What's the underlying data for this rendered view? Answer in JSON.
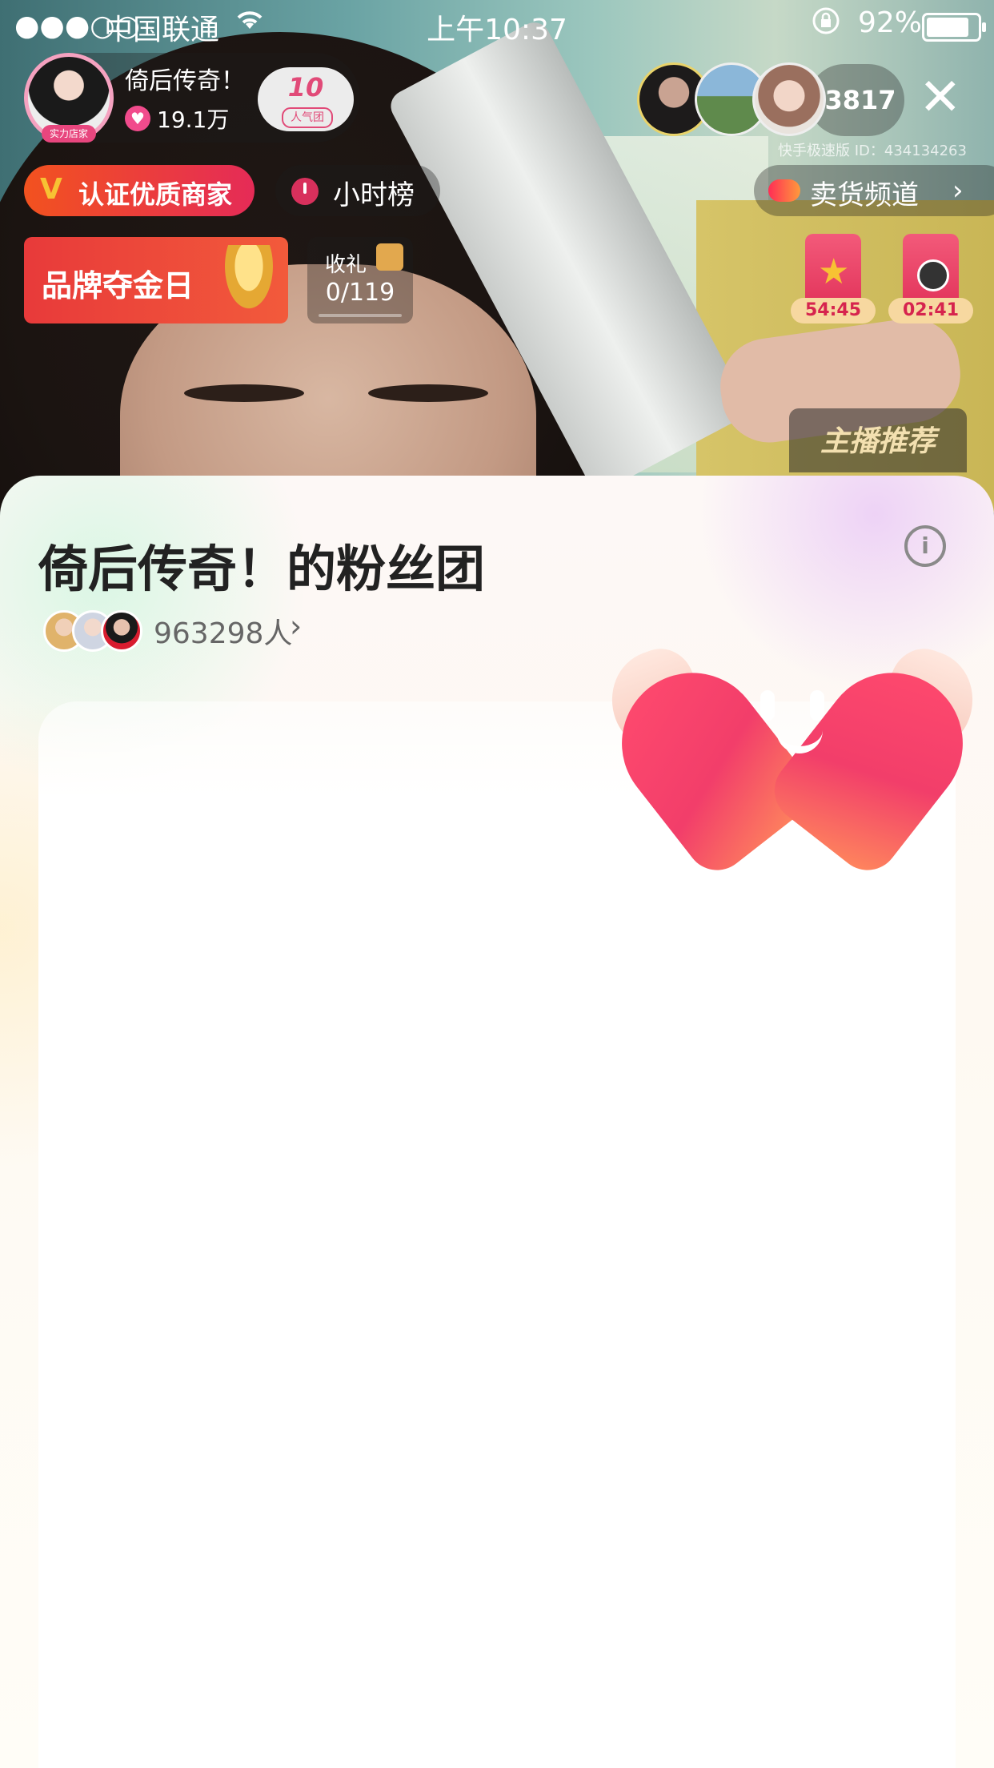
{
  "status_bar": {
    "signal": "●●●○○",
    "carrier": "中国联通",
    "wifi_icon": "wifi-icon",
    "time": "上午10:37",
    "lock_icon": "orientation-lock-icon",
    "battery_pct": "92%",
    "battery_level": 0.92
  },
  "host": {
    "name": "倚后传奇！",
    "fans": "19.1万",
    "avatar_tag": "实力店家",
    "rank_num": "10",
    "rank_label": "人气团"
  },
  "viewers": {
    "count": "3817",
    "id_text": "快手极速版 ID：434134263"
  },
  "badges": {
    "verified": "认证优质商家",
    "verified_mark": "V",
    "hourly": "小时榜",
    "sell_channel": "卖货频道",
    "chevron": "›",
    "brand_day": "品牌夺金日",
    "gift_label": "收礼",
    "gift_count": "0/119",
    "anchor_recommend": "主播推荐"
  },
  "timers": [
    "54:45",
    "02:41"
  ],
  "close_label": "✕",
  "fan_group": {
    "title": "倚后传奇！的粉丝团",
    "members": "963298人",
    "members_chevron": "›",
    "info_label": "i"
  },
  "colors": {
    "accent_red": "#e52b57",
    "verified_orange": "#f2521f",
    "heart_pink": "#f23e6a"
  }
}
